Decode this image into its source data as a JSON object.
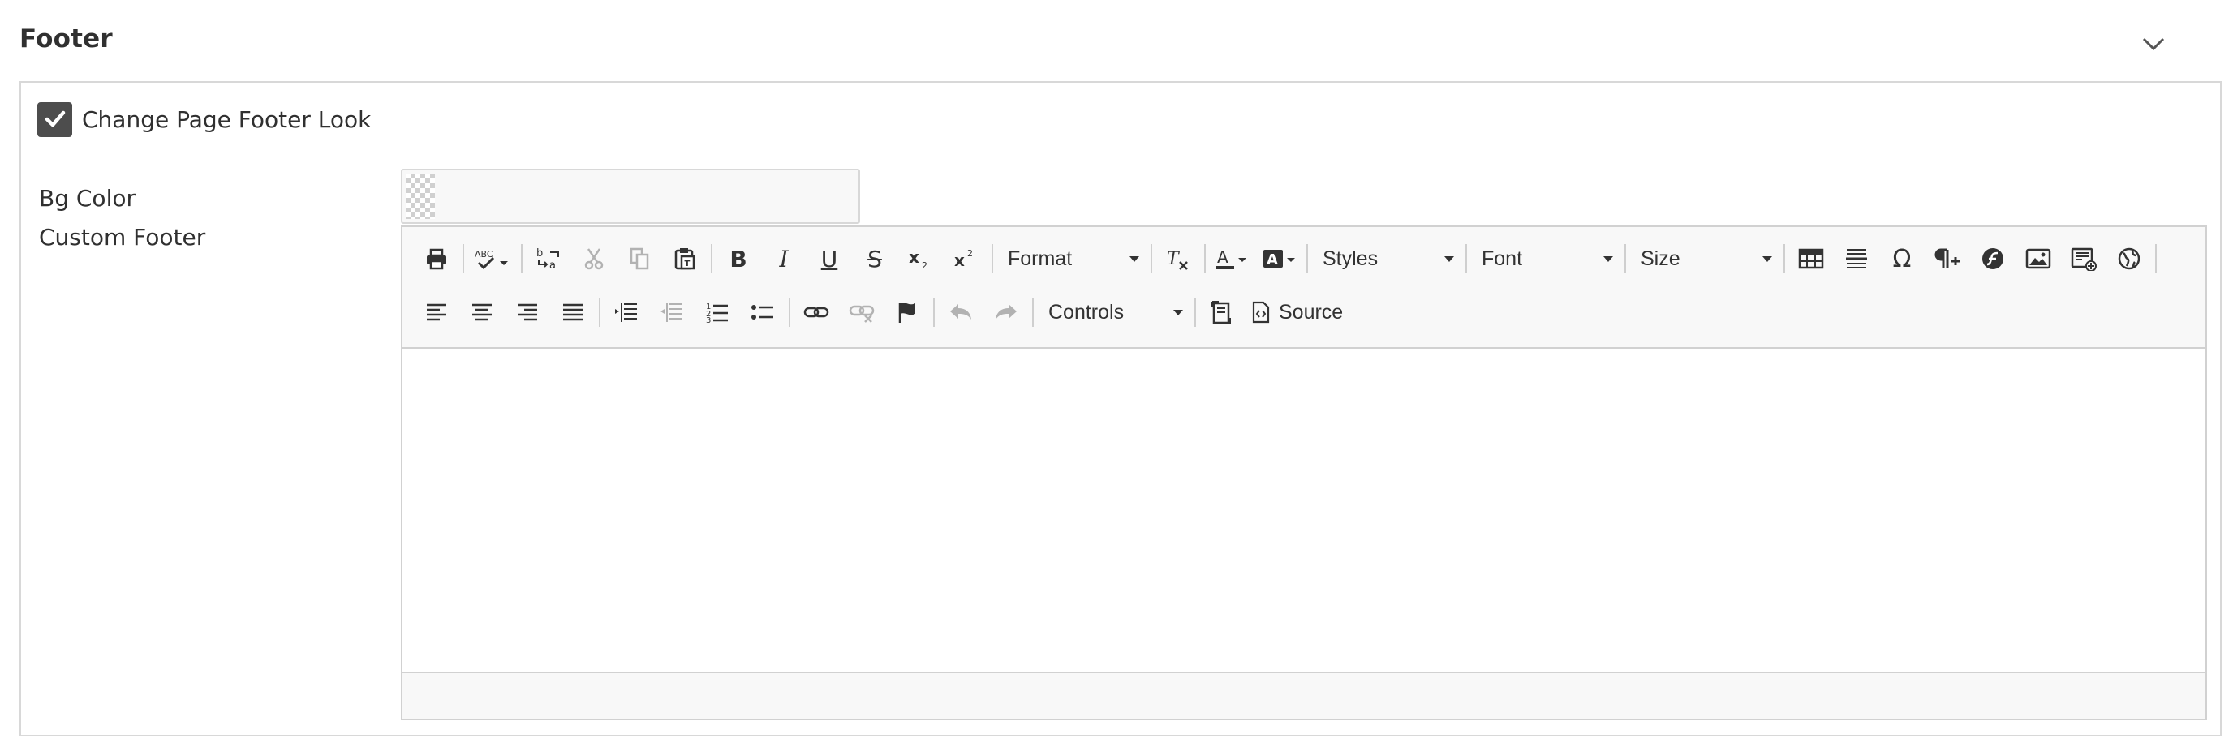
{
  "section": {
    "title": "Footer",
    "toggle_icon": "chevron-down-icon"
  },
  "checkbox": {
    "label": "Change Page Footer Look",
    "checked": true
  },
  "fields": {
    "bg_color_label": "Bg Color",
    "custom_footer_label": "Custom Footer"
  },
  "color_picker": {
    "value": "transparent"
  },
  "editor": {
    "toolbar": {
      "format_label": "Format",
      "styles_label": "Styles",
      "font_label": "Font",
      "size_label": "Size",
      "controls_label": "Controls",
      "source_label": "Source",
      "bold_label": "B",
      "italic_label": "I",
      "underline_label": "U",
      "strike_label": "S",
      "special_char_label": "Ω"
    },
    "content": ""
  },
  "colors": {
    "checkbox_fill": "#4d4d4d",
    "toolbar_bg": "#f8f8f8",
    "border": "#d1d1d1"
  }
}
